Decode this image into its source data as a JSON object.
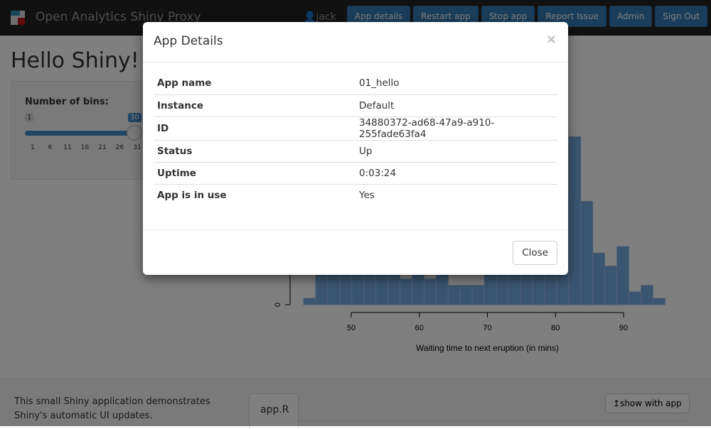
{
  "navbar": {
    "brand": "Open Analytics Shiny Proxy",
    "user": "jack",
    "buttons": [
      "App details",
      "Restart app",
      "Stop app",
      "Report Issue",
      "Admin",
      "Sign Out"
    ]
  },
  "app": {
    "title": "Hello Shiny!",
    "slider": {
      "label": "Number of bins:",
      "min": "1",
      "value": "30",
      "value_num": 30,
      "max_num": 50,
      "ticks": [
        "1",
        "6",
        "11",
        "16",
        "21",
        "26",
        "31"
      ]
    },
    "description": "This small Shiny application demonstrates Shiny's automatic UI updates.",
    "tab": "app.R",
    "show_with_app": "show with app"
  },
  "chart_data": {
    "type": "bar",
    "xlabel": "Waiting time to next eruption (in mins)",
    "xticks": [
      50,
      60,
      70,
      80,
      90
    ],
    "yticks": [
      0
    ],
    "bin_start": 43,
    "bin_width": 1.77,
    "values": [
      1,
      5,
      7,
      6,
      8,
      9,
      7,
      5,
      4,
      7,
      4,
      6,
      3,
      3,
      3,
      6,
      8,
      10,
      12,
      14,
      13,
      17,
      26,
      16,
      8,
      6,
      9,
      2,
      3,
      1
    ],
    "color": "#75aae0"
  },
  "modal": {
    "title": "App Details",
    "close_x": "×",
    "close_button": "Close",
    "rows": [
      {
        "k": "App name",
        "v": "01_hello"
      },
      {
        "k": "Instance",
        "v": "Default"
      },
      {
        "k": "ID",
        "v": "34880372-ad68-47a9-a910-255fade63fa4"
      },
      {
        "k": "Status",
        "v": "Up"
      },
      {
        "k": "Uptime",
        "v": "0:03:24"
      },
      {
        "k": "App is in use",
        "v": "Yes"
      }
    ]
  }
}
